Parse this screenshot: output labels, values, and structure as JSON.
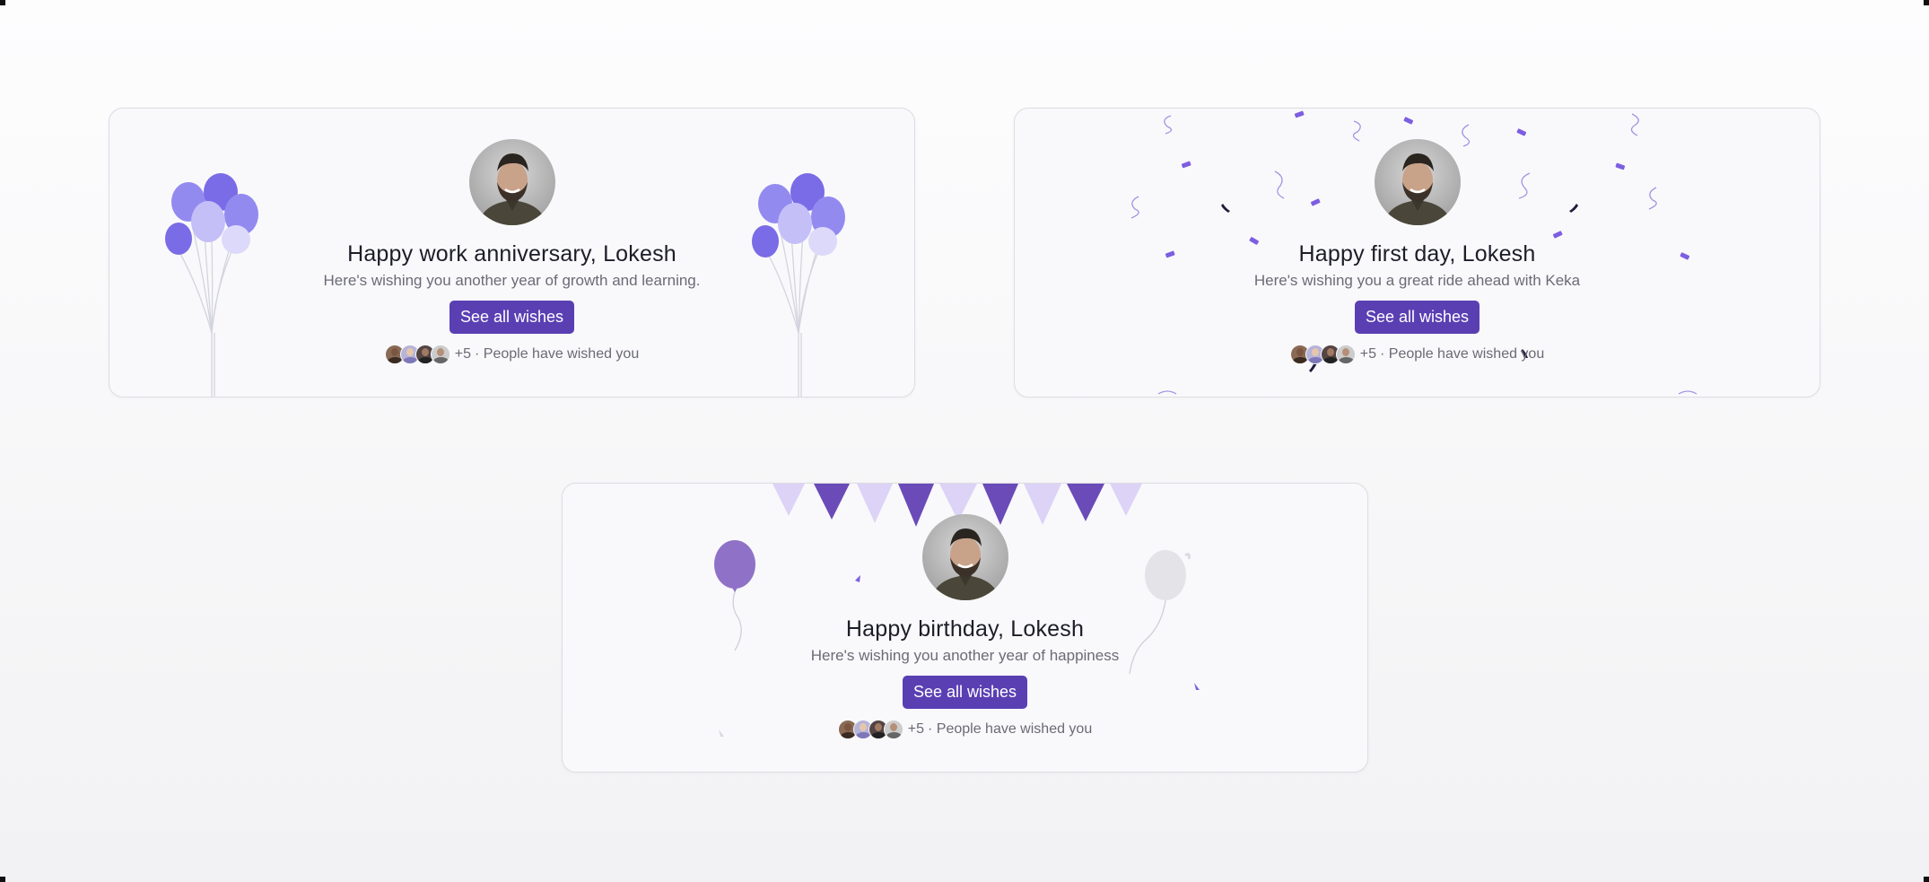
{
  "cards": {
    "anniversary": {
      "title": "Happy work anniversary, Lokesh",
      "subtitle": "Here's wishing you another year of growth and learning.",
      "button_label": "See all wishes",
      "wish_count": "+5",
      "wish_text": "· People have wished you"
    },
    "first_day": {
      "title": "Happy first day, Lokesh",
      "subtitle": "Here's wishing you a great ride ahead with Keka",
      "button_label": "See all wishes",
      "wish_count": "+5",
      "wish_text": "· People have wished you"
    },
    "birthday": {
      "title": "Happy birthday, Lokesh",
      "subtitle": "Here's wishing you another year of happiness",
      "button_label": "See all wishes",
      "wish_count": "+5",
      "wish_text": "· People have wished you"
    }
  },
  "icons": {
    "avatar": "profile-photo",
    "decorations": [
      "balloon-bunch-icon",
      "confetti-icon",
      "bunting-flags-icon",
      "single-balloon-icon"
    ]
  },
  "colors": {
    "accent": "#5a3fb3",
    "balloon_dark": "#7a6be6",
    "balloon_mid": "#938af0",
    "balloon_light": "#c4bff7",
    "bunting_dark": "#6a4bb8",
    "bunting_light": "#ddd3f6",
    "card_bg": "#f9f9fc"
  }
}
